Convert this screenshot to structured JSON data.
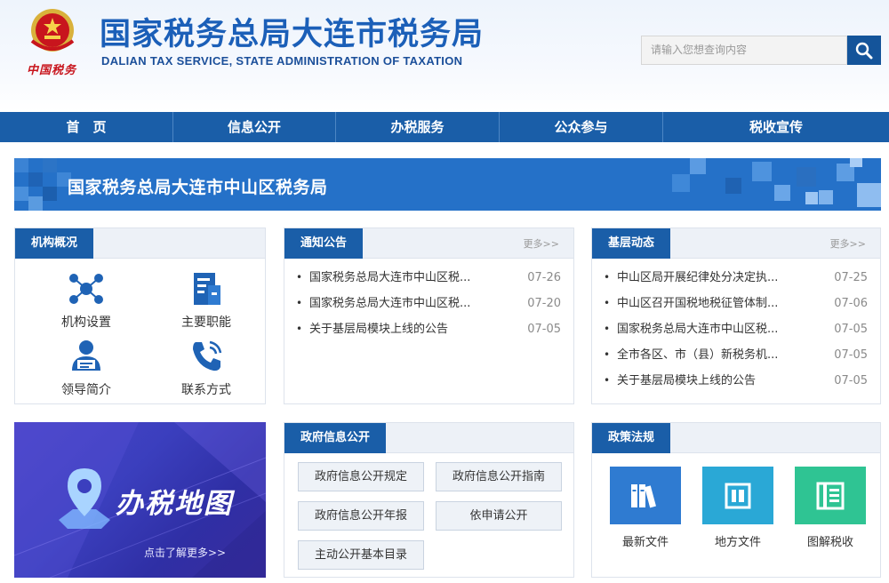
{
  "header": {
    "title": "国家税务总局大连市税务局",
    "subtitle": "DALIAN TAX SERVICE, STATE ADMINISTRATION OF TAXATION",
    "emblem_text": "中国税务",
    "search_placeholder": "请输入您想查询内容"
  },
  "nav": {
    "items": [
      "首　页",
      "信息公开",
      "办税服务",
      "公众参与",
      "税收宣传"
    ]
  },
  "banner": {
    "title": "国家税务总局大连市中山区税务局"
  },
  "org": {
    "title": "机构概况",
    "items": [
      {
        "label": "机构设置",
        "icon": "org-structure-icon"
      },
      {
        "label": "主要职能",
        "icon": "building-icon"
      },
      {
        "label": "领导简介",
        "icon": "leader-icon"
      },
      {
        "label": "联系方式",
        "icon": "phone-icon"
      }
    ]
  },
  "notices": {
    "title": "通知公告",
    "more": "更多>>",
    "items": [
      {
        "text": "国家税务总局大连市中山区税...",
        "date": "07-26"
      },
      {
        "text": "国家税务总局大连市中山区税...",
        "date": "07-20"
      },
      {
        "text": "关于基层局模块上线的公告",
        "date": "07-05"
      }
    ]
  },
  "grassroots": {
    "title": "基层动态",
    "more": "更多>>",
    "items": [
      {
        "text": "中山区局开展纪律处分决定执...",
        "date": "07-25"
      },
      {
        "text": "中山区召开国税地税征管体制...",
        "date": "07-06"
      },
      {
        "text": "国家税务总局大连市中山区税...",
        "date": "07-05"
      },
      {
        "text": "全市各区、市（县）新税务机...",
        "date": "07-05"
      },
      {
        "text": "关于基层局模块上线的公告",
        "date": "07-05"
      }
    ]
  },
  "map_promo": {
    "title": "办税地图",
    "more": "点击了解更多>>"
  },
  "gov_info": {
    "title": "政府信息公开",
    "buttons": [
      "政府信息公开规定",
      "政府信息公开指南",
      "政府信息公开年报",
      "依申请公开",
      "主动公开基本目录"
    ]
  },
  "policy": {
    "title": "政策法规",
    "items": [
      {
        "label": "最新文件",
        "color": "#2f7bd1",
        "icon": "books-icon"
      },
      {
        "label": "地方文件",
        "color": "#2aa8d6",
        "icon": "document-icon"
      },
      {
        "label": "图解税收",
        "color": "#2fc493",
        "icon": "chart-book-icon"
      }
    ]
  },
  "colors": {
    "primary": "#1a5ea8",
    "title_blue": "#1b5fb8",
    "banner_blue": "#2571c8"
  }
}
